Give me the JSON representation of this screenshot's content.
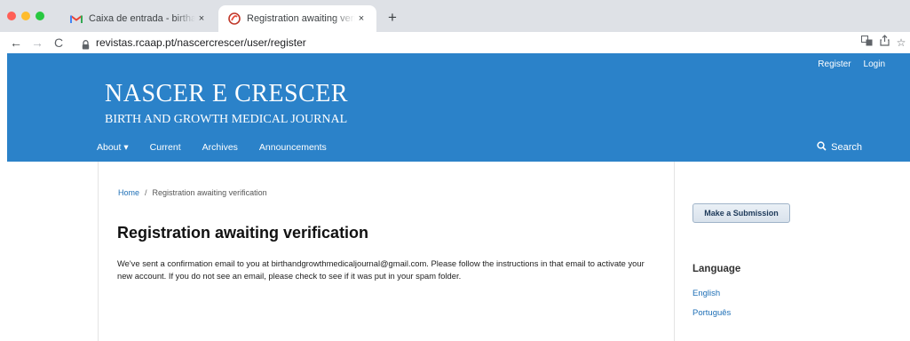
{
  "browser": {
    "tabs": [
      {
        "title": "Caixa de entrada - birthandgro",
        "icon": "gmail-icon"
      },
      {
        "title": "Registration awaiting verificatio",
        "icon": "journal-favicon-icon"
      }
    ],
    "new_tab": "+",
    "close_glyph": "×",
    "url": "revistas.rcaap.pt/nascercrescer/user/register"
  },
  "header": {
    "user_nav": {
      "register": "Register",
      "login": "Login"
    },
    "title": "NASCER E CRESCER",
    "subtitle": "BIRTH AND GROWTH MEDICAL JOURNAL",
    "nav": {
      "about": "About ▾",
      "current": "Current",
      "archives": "Archives",
      "announcements": "Announcements"
    },
    "search": "Search",
    "background_color": "#2b82c9"
  },
  "breadcrumb": {
    "home": "Home",
    "separator": "/",
    "current": "Registration awaiting verification"
  },
  "main": {
    "title": "Registration awaiting verification",
    "message": "We've sent a confirmation email to you at birthandgrowthmedicaljournal@gmail.com. Please follow the instructions in that email to activate your new account. If you do not see an email, please check to see if it was put in your spam folder."
  },
  "sidebar": {
    "submit_button": "Make a Submission",
    "language_heading": "Language",
    "languages": [
      "English",
      "Português"
    ]
  }
}
